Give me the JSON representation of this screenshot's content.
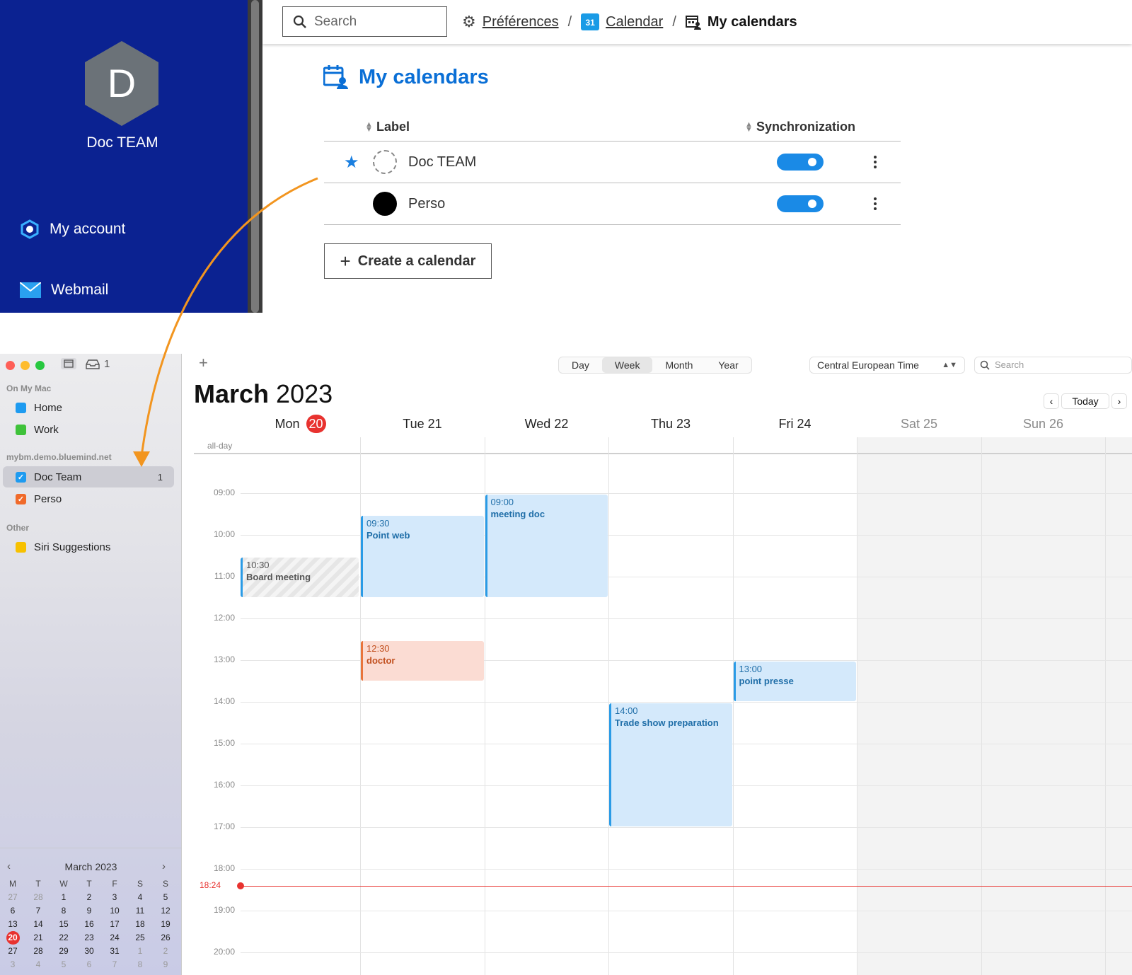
{
  "bluemind": {
    "sidebar": {
      "avatar_letter": "D",
      "user_name": "Doc TEAM",
      "nav": [
        {
          "label": "My account",
          "icon": "account-icon"
        },
        {
          "label": "Webmail",
          "icon": "mail-icon"
        }
      ]
    },
    "topbar": {
      "search_placeholder": "Search",
      "breadcrumb": [
        {
          "label": "Préférences",
          "icon": "gear-icon"
        },
        {
          "label": "Calendar",
          "icon": "calendar-31-icon",
          "icon_text": "31"
        },
        {
          "label": "My calendars",
          "icon": "calendar-user-icon"
        }
      ],
      "separator": "/"
    },
    "page_title": "My calendars",
    "table": {
      "headers": {
        "label": "Label",
        "sync": "Synchronization"
      },
      "rows": [
        {
          "name": "Doc TEAM",
          "default": true,
          "color": "dashed",
          "sync": true
        },
        {
          "name": "Perso",
          "default": false,
          "color": "#000000",
          "sync": true
        }
      ]
    },
    "create_button": "Create a calendar",
    "colors": {
      "sidebar_bg": "#0b2291",
      "accent": "#0a6fd6",
      "toggle": "#1a8ae6"
    }
  },
  "mac_calendar": {
    "toolbar": {
      "inbox_count": "1",
      "add_label": "+"
    },
    "sidebar": {
      "sections": [
        {
          "header": "On My Mac",
          "items": [
            {
              "label": "Home",
              "color": "#1e9bf0",
              "checked": false
            },
            {
              "label": "Work",
              "color": "#3fc23a",
              "checked": false
            }
          ]
        },
        {
          "header": "mybm.demo.bluemind.net",
          "items": [
            {
              "label": "Doc Team",
              "color": "#1e9bf0",
              "checked": true,
              "count": "1",
              "selected": true
            },
            {
              "label": "Perso",
              "color": "#f06a2a",
              "checked": true
            }
          ]
        },
        {
          "header": "Other",
          "items": [
            {
              "label": "Siri Suggestions",
              "color": "#f7c100",
              "checked": false
            }
          ]
        }
      ]
    },
    "mini_calendar": {
      "title": "March 2023",
      "weekdays": [
        "M",
        "T",
        "W",
        "T",
        "F",
        "S",
        "S"
      ],
      "weeks": [
        [
          "27",
          "28",
          "1",
          "2",
          "3",
          "4",
          "5"
        ],
        [
          "6",
          "7",
          "8",
          "9",
          "10",
          "11",
          "12"
        ],
        [
          "13",
          "14",
          "15",
          "16",
          "17",
          "18",
          "19"
        ],
        [
          "20",
          "21",
          "22",
          "23",
          "24",
          "25",
          "26"
        ],
        [
          "27",
          "28",
          "29",
          "30",
          "31",
          "1",
          "2"
        ],
        [
          "3",
          "4",
          "5",
          "6",
          "7",
          "8",
          "9"
        ]
      ],
      "today": "20"
    },
    "views": [
      "Day",
      "Week",
      "Month",
      "Year"
    ],
    "active_view": "Week",
    "timezone": "Central European Time",
    "search_placeholder": "Search",
    "title_month": "March",
    "title_year": "2023",
    "today_button": "Today",
    "days": [
      {
        "name": "Mon",
        "num": "20",
        "today": true
      },
      {
        "name": "Tue",
        "num": "21"
      },
      {
        "name": "Wed",
        "num": "22"
      },
      {
        "name": "Thu",
        "num": "23"
      },
      {
        "name": "Fri",
        "num": "24"
      },
      {
        "name": "Sat",
        "num": "25",
        "weekend": true
      },
      {
        "name": "Sun",
        "num": "26",
        "weekend": true
      }
    ],
    "allday_label": "all-day",
    "hours": [
      "09:00",
      "10:00",
      "11:00",
      "12:00",
      "13:00",
      "14:00",
      "15:00",
      "16:00",
      "17:00",
      "18:00",
      "19:00",
      "20:00"
    ],
    "current_time": "18:24",
    "events": [
      {
        "day": 0,
        "start": "10:30",
        "end": "11:30",
        "title": "Board meeting",
        "style": "grey"
      },
      {
        "day": 1,
        "start": "09:30",
        "end": "11:30",
        "title": "Point web",
        "style": "blue"
      },
      {
        "day": 1,
        "start": "12:30",
        "end": "13:30",
        "title": "doctor",
        "style": "red"
      },
      {
        "day": 2,
        "start": "09:00",
        "end": "11:30",
        "title": "meeting doc",
        "style": "blue"
      },
      {
        "day": 3,
        "start": "14:00",
        "end": "17:00",
        "title": "Trade show preparation",
        "style": "blue"
      },
      {
        "day": 4,
        "start": "13:00",
        "end": "14:00",
        "title": "point presse",
        "style": "blue"
      }
    ]
  }
}
